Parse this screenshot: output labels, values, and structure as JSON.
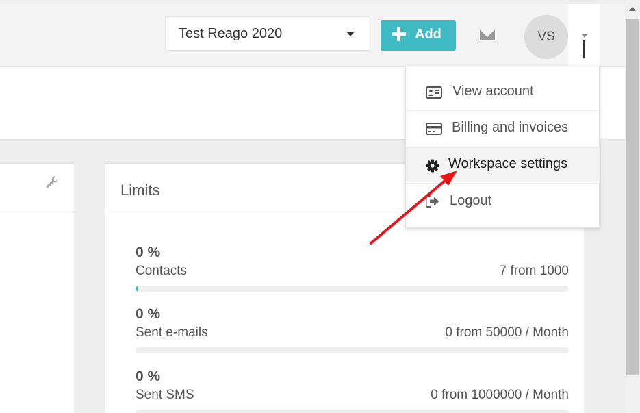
{
  "header": {
    "workspace_selector": {
      "value": "Test Reago 2020"
    },
    "add_label": "Add",
    "user_initials": "VS"
  },
  "user_menu": {
    "items": [
      {
        "label": "View account",
        "icon": "id-card-icon"
      },
      {
        "label": "Billing and invoices",
        "icon": "credit-card-icon"
      },
      {
        "label": "Workspace settings",
        "icon": "gear-icon"
      },
      {
        "label": "Logout",
        "icon": "logout-icon"
      }
    ],
    "active_item": "Workspace settings"
  },
  "limits": {
    "title": "Limits",
    "items": [
      {
        "percent": "0 %",
        "name": "Contacts",
        "amount": "7 from 1000",
        "fraction": 0.007
      },
      {
        "percent": "0 %",
        "name": "Sent e-mails",
        "amount": "0 from 50000 / Month",
        "fraction": 0
      },
      {
        "percent": "0 %",
        "name": "Sent SMS",
        "amount": "0 from 1000000 / Month",
        "fraction": 0
      }
    ]
  },
  "colors": {
    "accent": "#3fbac2",
    "annotation_arrow": "#e8141a"
  }
}
